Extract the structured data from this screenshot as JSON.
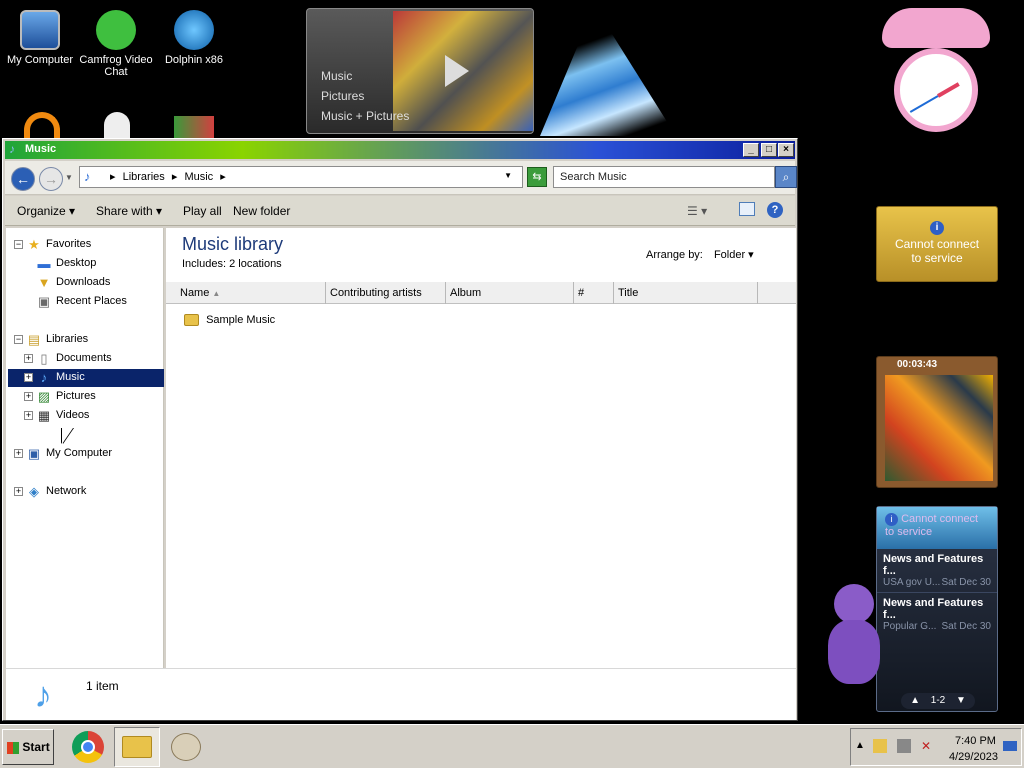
{
  "desktop": {
    "icons": [
      {
        "label": "My Computer",
        "icon": "computer-icon"
      },
      {
        "label": "Camfrog Video Chat",
        "icon": "camfrog-icon"
      },
      {
        "label": "Dolphin x86",
        "icon": "dolphin-icon"
      }
    ]
  },
  "media_gadget": {
    "items": [
      "Music",
      "Pictures",
      "Music + Pictures"
    ]
  },
  "window": {
    "title": "Music",
    "breadcrumb": [
      "Libraries",
      "Music"
    ],
    "search_placeholder": "Search Music",
    "toolbar": {
      "organize": "Organize",
      "share_with": "Share with",
      "play_all": "Play all",
      "new_folder": "New folder"
    },
    "nav": {
      "favorites": "Favorites",
      "desktop": "Desktop",
      "downloads": "Downloads",
      "recent_places": "Recent Places",
      "libraries": "Libraries",
      "documents": "Documents",
      "music": "Music",
      "pictures": "Pictures",
      "videos": "Videos",
      "my_computer": "My Computer",
      "network": "Network"
    },
    "library": {
      "title": "Music library",
      "includes_label": "Includes:",
      "includes_value": "2 locations",
      "arrange_label": "Arrange by:",
      "arrange_value": "Folder"
    },
    "columns": [
      "Name",
      "Contributing artists",
      "Album",
      "#",
      "Title"
    ],
    "items": [
      "Sample Music"
    ],
    "details": "1 item"
  },
  "gadgets": {
    "weather_error": "Cannot connect to service",
    "puzzle_timer": "00:03:43",
    "feed_error": "Cannot connect to service",
    "feeds": [
      {
        "title": "News and Features f...",
        "source": "USA gov U...",
        "date": "Sat Dec 30"
      },
      {
        "title": "News and Features f...",
        "source": "Popular G...",
        "date": "Sat Dec 30"
      }
    ],
    "feed_pager": "1-2"
  },
  "taskbar": {
    "start": "Start",
    "time": "7:40 PM",
    "date": "4/29/2023"
  }
}
